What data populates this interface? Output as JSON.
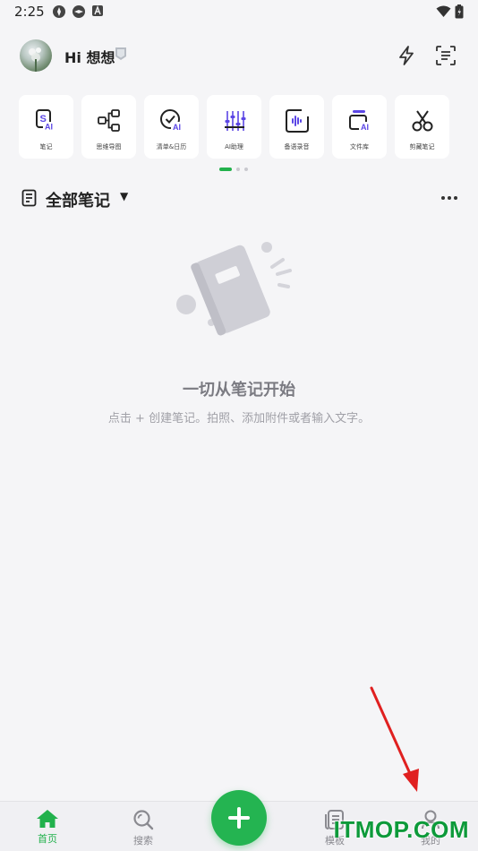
{
  "status_bar": {
    "time": "2:25"
  },
  "header": {
    "greeting": "Hi 想想"
  },
  "tools": [
    {
      "label": "笔记",
      "icon": "ai-note-icon"
    },
    {
      "label": "思维导图",
      "icon": "mindmap-icon"
    },
    {
      "label": "清单&日历",
      "icon": "checklist-ai-icon"
    },
    {
      "label": "AI助理",
      "icon": "ai-assistant-icon"
    },
    {
      "label": "备语录音",
      "icon": "voice-record-icon"
    },
    {
      "label": "文件库",
      "icon": "file-library-icon"
    },
    {
      "label": "剪藏笔记",
      "icon": "clip-note-icon"
    }
  ],
  "section": {
    "title": "全部笔记"
  },
  "empty_state": {
    "title": "一切从笔记开始",
    "subtitle": "点击 + 创建笔记。拍照、添加附件或者输入文字。"
  },
  "bottom_nav": {
    "home": "首页",
    "search": "搜索",
    "templates": "模板",
    "mine": "我的"
  },
  "watermark": "ITMOP.COM",
  "colors": {
    "accent": "#22b14c",
    "ai_purple": "#5b46e5",
    "annotation": "#e02020"
  }
}
